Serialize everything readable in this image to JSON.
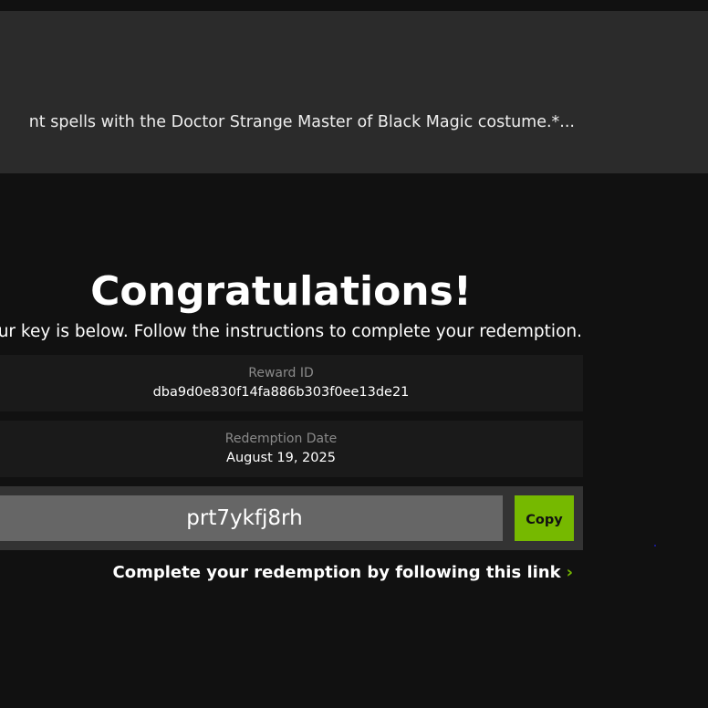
{
  "banner": {
    "text": "nt spells with the Doctor Strange Master of Black Magic costume.*..."
  },
  "main": {
    "title": "Congratulations!",
    "subtitle": "ur key is below. Follow the instructions to complete your redemption."
  },
  "reward": {
    "label": "Reward ID",
    "value": "dba9d0e830f14fa886b303f0ee13de21"
  },
  "redemption": {
    "label": "Redemption Date",
    "value": "August 19, 2025"
  },
  "key": {
    "value": "prt7ykfj8rh",
    "copy_label": "Copy"
  },
  "link": {
    "label": "Complete your redemption by following this link",
    "chevron": "›"
  },
  "colors": {
    "accent": "#76b900",
    "background": "#111111",
    "banner": "#2b2b2b",
    "panel": "#1a1a1a",
    "key_field": "#666666"
  },
  "icons": {
    "chevron": "chevron-right-icon"
  }
}
